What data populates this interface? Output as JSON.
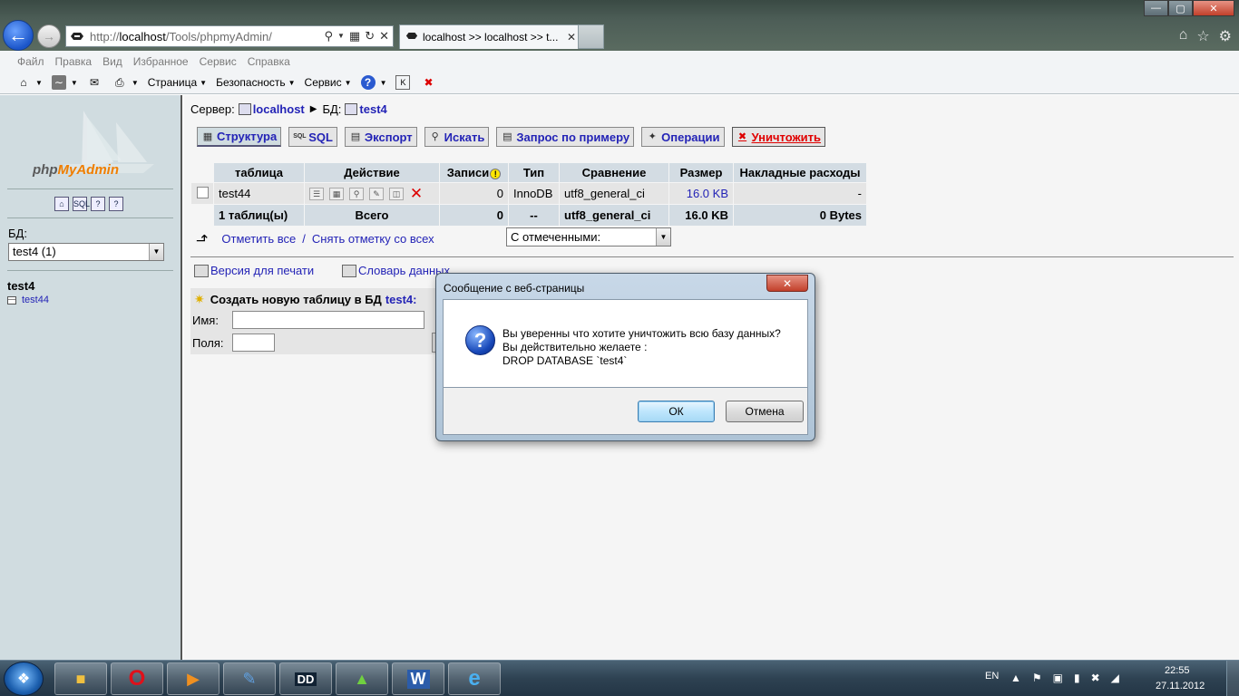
{
  "browser": {
    "url_prefix": "http://",
    "url_host": "localhost",
    "url_path": "/Tools/phpmyAdmin/",
    "tab_title": "localhost >> localhost >> t...",
    "menu": [
      "Файл",
      "Правка",
      "Вид",
      "Избранное",
      "Сервис",
      "Справка"
    ],
    "commands": {
      "page": "Страница",
      "safety": "Безопасность",
      "tools": "Сервис"
    }
  },
  "left": {
    "logo_php": "php",
    "logo_myadmin": "MyAdmin",
    "db_label": "БД:",
    "db_select_value": "test4 (1)",
    "db_name": "test4",
    "tables": [
      "test44"
    ]
  },
  "main": {
    "breadcrumb": {
      "server_label": "Сервер:",
      "server_name": "localhost",
      "db_label": "БД:",
      "db_name": "test4"
    },
    "tabs": [
      "Структура",
      "SQL",
      "Экспорт",
      "Искать",
      "Запрос по примеру",
      "Операции",
      "Уничтожить"
    ],
    "table": {
      "headers": [
        "таблица",
        "Действие",
        "Записи",
        "Тип",
        "Сравнение",
        "Размер",
        "Накладные расходы"
      ],
      "rows": [
        {
          "name": "test44",
          "records": "0",
          "type": "InnoDB",
          "collation": "utf8_general_ci",
          "size": "16.0 KB",
          "overhead": "-"
        }
      ],
      "summary": {
        "count": "1 таблиц(ы)",
        "label": "Всего",
        "records": "0",
        "type": "--",
        "collation": "utf8_general_ci",
        "size": "16.0 KB",
        "overhead": "0 Bytes"
      }
    },
    "check_all": "Отметить все",
    "uncheck_all": "Снять отметку со всех",
    "separator": "/",
    "with_selected": "С отмеченными:",
    "print_version": "Версия для печати",
    "data_dictionary": "Словарь данных",
    "create_table": {
      "title": "Создать новую таблицу в БД",
      "db": "test4:",
      "name_label": "Имя:",
      "name_value": "",
      "fields_label": "Поля:",
      "fields_value": ""
    }
  },
  "dialog": {
    "title": "Сообщение с веб-страницы",
    "line1": "Вы уверенны что хотите уничтожить всю базу данных?",
    "line2": "Вы действительно желаете  :",
    "line3": "DROP DATABASE `test4`",
    "ok": "ОК",
    "cancel": "Отмена"
  },
  "taskbar": {
    "lang": "EN",
    "time": "22:55",
    "date": "27.11.2012"
  },
  "colors": {
    "link": "#2323b6",
    "danger": "#e00000",
    "left_bg": "#d0dce0",
    "header_bg": "#d3dce3"
  }
}
